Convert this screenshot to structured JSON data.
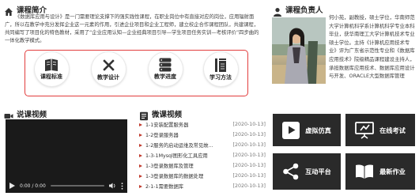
{
  "intro": {
    "title": "课程简介",
    "paragraph": "《数据库应用与设计》是一门需要理论支撑下的强实践性课程，在职业岗位中有直接对应的岗位，应用辐射面广，所以在教学中充分发挥企业这一元素的作用，引进企业项目和企业工程师，建立校企合作课程团队，共建课程，共同编写了项目化的特色教材，采用了“企业应用认知—企业经典项目引导—学生项目任务实训—考核评价”四步曲的一体化教学模式。",
    "buttons": [
      {
        "label": "课程标准",
        "icon": "course-standard-icon"
      },
      {
        "label": "教学设计",
        "icon": "teaching-design-icon"
      },
      {
        "label": "教学进度",
        "icon": "teaching-progress-icon"
      },
      {
        "label": "学习方法",
        "icon": "learning-method-icon"
      }
    ]
  },
  "person": {
    "title": "课程负责人",
    "bio": "何小苑，副教授，硕士学位，华南师范大学计算机科学系计算机科学专业本科毕业，获华南理工大学计算机技术专业硕士学位。主持《计算机应用技术专业》评为广东省示范性专业和《数据库应用技术》院级精品课程建设主持人，承担数据库应用技术、数据库应用设计与开发、ORACLE大型数据库管理"
  },
  "video": {
    "title": "说课视频",
    "time": "0:00 / 0:00"
  },
  "micro": {
    "title": "微课视频",
    "items": [
      {
        "text": "1-1安装配置服务器",
        "date": "[2020-10-13]"
      },
      {
        "text": "1-2登录服务器",
        "date": "[2020-10-13]"
      },
      {
        "text": "1-2服务的启动运维及常见故...",
        "date": "[2020-10-13]"
      },
      {
        "text": "1-3-1Mysql图形化工具应用",
        "date": "[2020-10-13]"
      },
      {
        "text": "1-3登录数据库及管理",
        "date": "[2020-10-13]"
      },
      {
        "text": "1-3登录数据库的数据处理",
        "date": "[2020-10-13]"
      },
      {
        "text": "2-1-1需要数据库",
        "date": "[2020-10-13]"
      }
    ]
  },
  "tiles": [
    {
      "label": "虚拟仿真",
      "icon": "play-icon"
    },
    {
      "label": "在线考试",
      "icon": "presentation-icon"
    },
    {
      "label": "互动平台",
      "icon": "share-icon"
    },
    {
      "label": "最新作业",
      "icon": "book-icon"
    }
  ],
  "colors": {
    "accent_red": "#e23d3d",
    "tile_bg": "#2a2a2a",
    "bullet_red": "#c0392b"
  }
}
